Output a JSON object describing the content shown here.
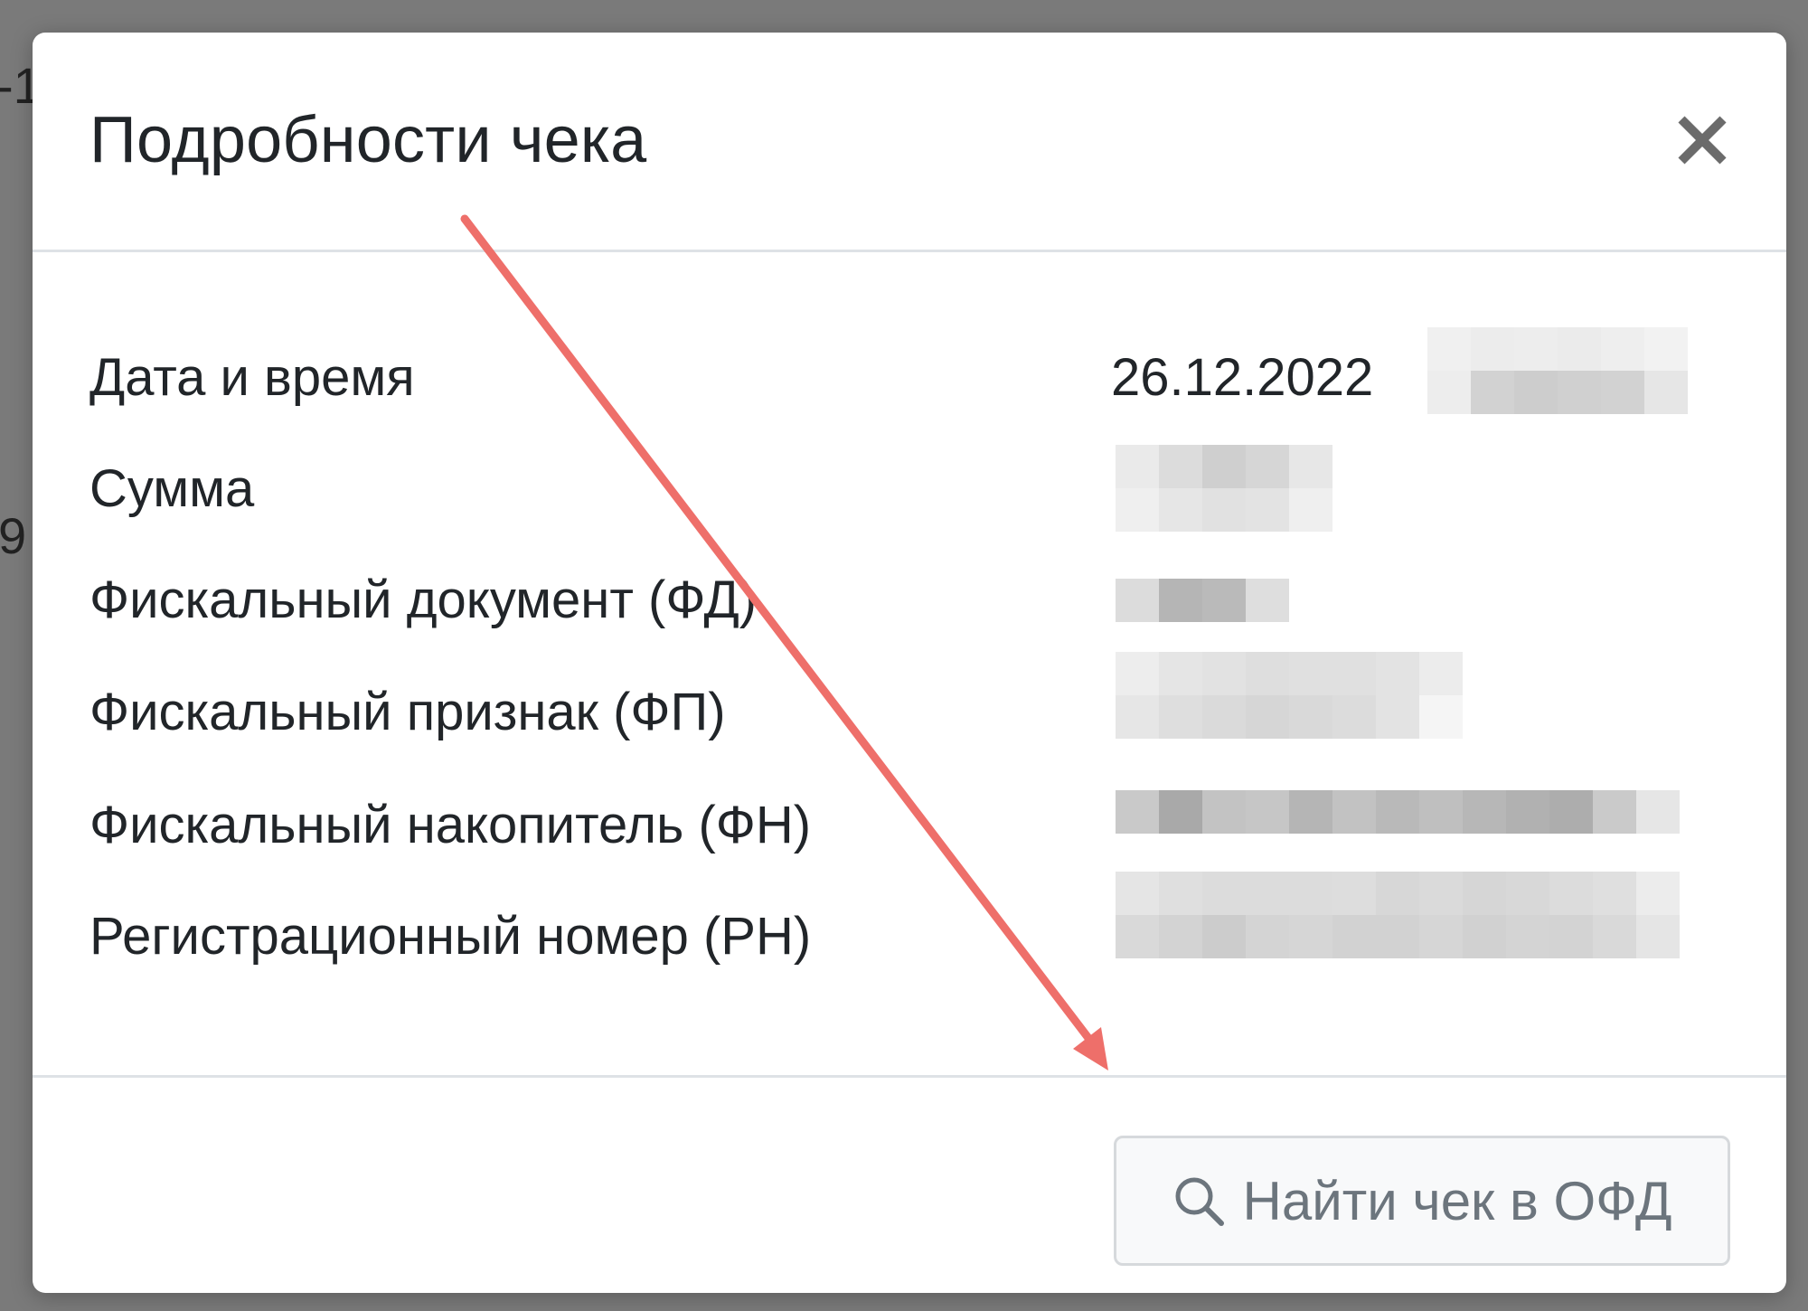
{
  "backdrop": {
    "fragment_top": "-1",
    "fragment_mid": "9"
  },
  "modal": {
    "title": "Подробности чека",
    "close_icon": "close-icon",
    "rows": [
      {
        "label": "Дата и время",
        "value": "26.12.2022"
      },
      {
        "label": "Сумма",
        "value": ""
      },
      {
        "label": "Фискальный документ (ФД)",
        "value": ""
      },
      {
        "label": "Фискальный признак (ФП)",
        "value": ""
      },
      {
        "label": "Фискальный накопитель (ФН)",
        "value": ""
      },
      {
        "label": "Регистрационный номер (РН)",
        "value": ""
      }
    ],
    "footer": {
      "find_button_label": "Найти чек в ОФД",
      "find_button_icon": "search-icon"
    }
  },
  "annotation": {
    "arrow_color": "#ee6f6a",
    "arrow_icon": "arrow-annotation"
  },
  "colors": {
    "backdrop": "#7a7a7a",
    "text": "#212529",
    "muted": "#6c757d",
    "divider": "#dee2e6"
  }
}
